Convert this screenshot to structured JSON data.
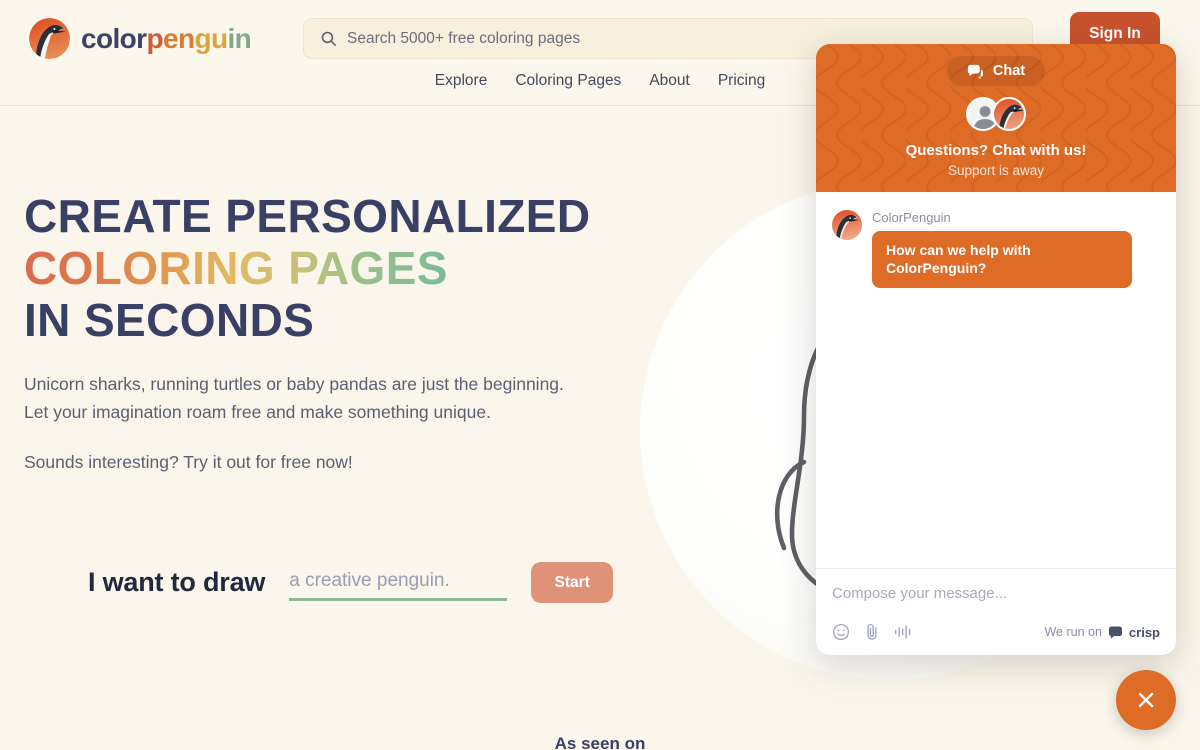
{
  "brand": {
    "name_part1": "color",
    "name_part2": "penguin",
    "logo_icon": "penguin-logo-icon",
    "accent_orange": "#df6c26",
    "accent_red": "#c9522e",
    "accent_salmon": "#e09278",
    "accent_green": "#8fb894",
    "heading_navy": "#3a3f65",
    "page_bg": "#faf6eb"
  },
  "header": {
    "search": {
      "placeholder": "Search 5000+ free coloring pages",
      "value": "",
      "icon": "search-icon"
    },
    "sign_in_label": "Sign In",
    "nav": [
      {
        "label": "Explore"
      },
      {
        "label": "Coloring Pages"
      },
      {
        "label": "About"
      },
      {
        "label": "Pricing"
      }
    ]
  },
  "hero": {
    "headline_line1": "Create personalized",
    "headline_line2": "coloring pages",
    "headline_line3": "in seconds",
    "paragraph1": "Unicorn sharks, running turtles or baby pandas are just the beginning. Let your imagination roam free and make something unique.",
    "paragraph2": "Sounds interesting? Try it out for free now!",
    "draw_label": "I want to draw",
    "draw_placeholder": "a creative penguin.",
    "draw_value": "",
    "start_label": "Start",
    "illustration": "penguin-line-art",
    "as_seen_on": "As seen on"
  },
  "chat": {
    "pill_label": "Chat",
    "pill_icon": "chat-bubbles-icon",
    "title": "Questions? Chat with us!",
    "status": "Support is away",
    "avatars": [
      {
        "name": "visitor-avatar"
      },
      {
        "name": "agent-penguin-avatar"
      }
    ],
    "messages": [
      {
        "sender": "ColorPenguin",
        "text": "How can we help with ColorPenguin?"
      }
    ],
    "compose_placeholder": "Compose your message...",
    "compose_value": "",
    "footer_icons": [
      "emoji-icon",
      "attachment-icon",
      "audio-message-icon"
    ],
    "powered_by_prefix": "We run on",
    "powered_by_name": "crisp",
    "close_icon": "close-icon"
  }
}
